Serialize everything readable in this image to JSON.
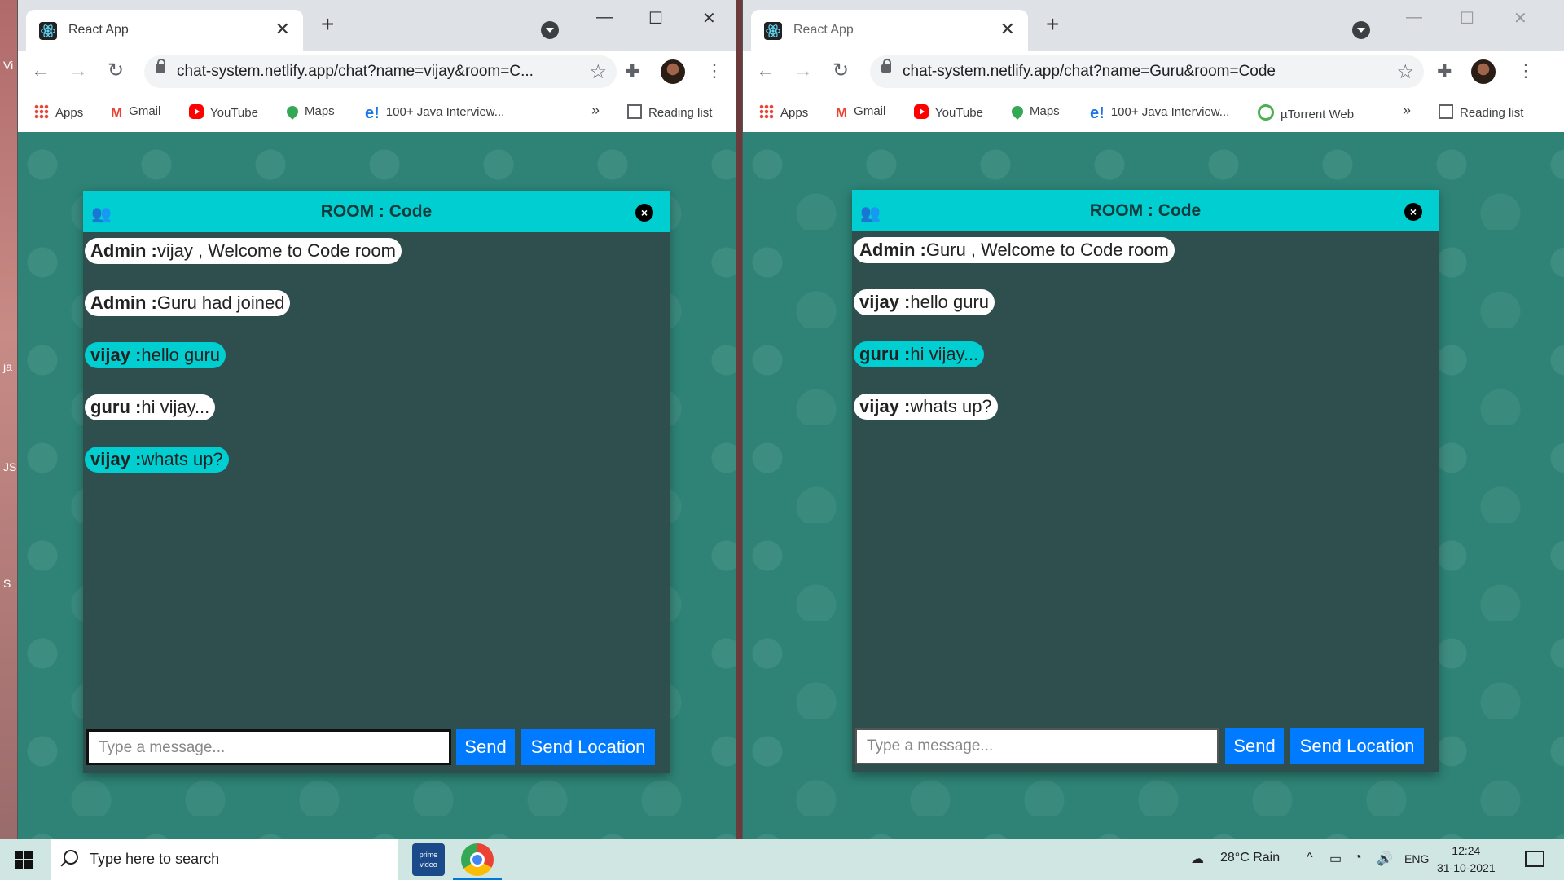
{
  "desktop": {
    "labels": [
      "Vi",
      "ja",
      "JS",
      "S"
    ]
  },
  "windows": [
    {
      "tab_title": "React App",
      "url": "chat-system.netlify.app/chat?name=vijay&room=C...",
      "bookmarks": [
        "Apps",
        "Gmail",
        "YouTube",
        "Maps",
        "100+ Java Interview..."
      ],
      "overflow": "»",
      "reading_list": "Reading list",
      "chat": {
        "room_title": "ROOM : Code",
        "messages": [
          {
            "sender": "Admin :",
            "text": "vijay , Welcome to Code room",
            "mine": false
          },
          {
            "sender": "Admin :",
            "text": "Guru had joined",
            "mine": false
          },
          {
            "sender": "vijay :",
            "text": "hello guru",
            "mine": true
          },
          {
            "sender": "guru :",
            "text": "hi vijay...",
            "mine": false
          },
          {
            "sender": "vijay :",
            "text": "whats up?",
            "mine": true
          }
        ],
        "input_placeholder": "Type a message...",
        "send_label": "Send",
        "send_location_label": "Send Location"
      }
    },
    {
      "tab_title": "React App",
      "url": "chat-system.netlify.app/chat?name=Guru&room=Code",
      "bookmarks": [
        "Apps",
        "Gmail",
        "YouTube",
        "Maps",
        "100+ Java Interview...",
        "µTorrent Web"
      ],
      "overflow": "»",
      "reading_list": "Reading list",
      "chat": {
        "room_title": "ROOM : Code",
        "messages": [
          {
            "sender": "Admin :",
            "text": "Guru , Welcome to Code room",
            "mine": false
          },
          {
            "sender": "vijay :",
            "text": "hello guru",
            "mine": false
          },
          {
            "sender": "guru :",
            "text": "hi vijay...",
            "mine": true
          },
          {
            "sender": "vijay :",
            "text": "whats up?",
            "mine": false
          }
        ],
        "input_placeholder": "Type a message...",
        "send_label": "Send",
        "send_location_label": "Send Location"
      }
    }
  ],
  "taskbar": {
    "search_placeholder": "Type here to search",
    "prime_label": "prime video",
    "weather": "28°C  Rain",
    "language": "ENG",
    "time": "12:24",
    "date": "31-10-2021"
  },
  "colors": {
    "chat_header": "#00ced1",
    "chat_body": "#2f4f4f",
    "send_button": "#007bff",
    "wallpaper": "#2e8376"
  }
}
